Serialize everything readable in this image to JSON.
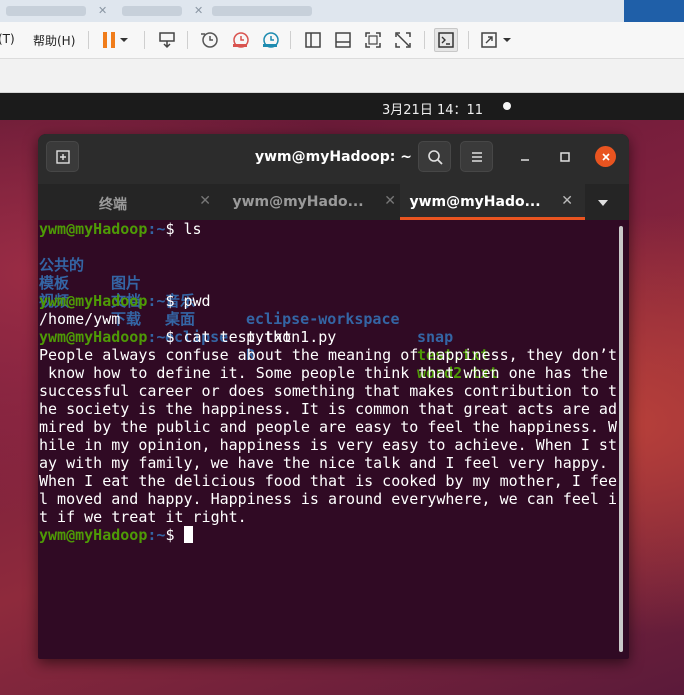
{
  "host": {
    "menus": [
      {
        "label": "(T)"
      },
      {
        "label": "帮助(H)"
      }
    ]
  },
  "desktop": {
    "clock": "3月21日  14：11"
  },
  "terminal": {
    "title": "ywm@myHadoop: ~",
    "tabs": [
      {
        "label": "终端"
      },
      {
        "label": "ywm@myHado..."
      },
      {
        "label": "ywm@myHado..."
      }
    ],
    "prompt": {
      "user_host": "ywm@myHadoop",
      "path": ":~",
      "symbol": "$ "
    },
    "commands": {
      "ls": "ls",
      "pwd": "pwd",
      "cat": "cat test.txt"
    },
    "ls_output": [
      [
        "公共的",
        "图片",
        "音乐",
        "eclipse-workspace",
        "snap"
      ],
      [
        "模板",
        "文档",
        "桌面",
        "python1.py",
        "test.txt"
      ],
      [
        "视频",
        "下载",
        "eclipse",
        "R",
        "word2.txt"
      ]
    ],
    "pwd_output": "/home/ywm",
    "cat_output": [
      "People always confuse about the meaning of happiness, they don’t",
      " know how to define it. Some people think that when one has the",
      "successful career or does something that makes contribution to t",
      "he society is the happiness. It is common that great acts are ad",
      "mired by the public and people are easy to feel the happiness. W",
      "hile in my opinion, happiness is very easy to achieve. When I st",
      "ay with my family, we have the nice talk and I feel very happy.",
      "When I eat the delicious food that is cooked by my mother, I fee",
      "l moved and happy. Happiness is around everywhere, we can feel i",
      "t if we treat it right."
    ]
  },
  "colors": {
    "prompt_green": "#4e9a06",
    "dir_blue": "#3465a4",
    "terminal_bg": "#300a24",
    "ubuntu_orange": "#e95420"
  }
}
